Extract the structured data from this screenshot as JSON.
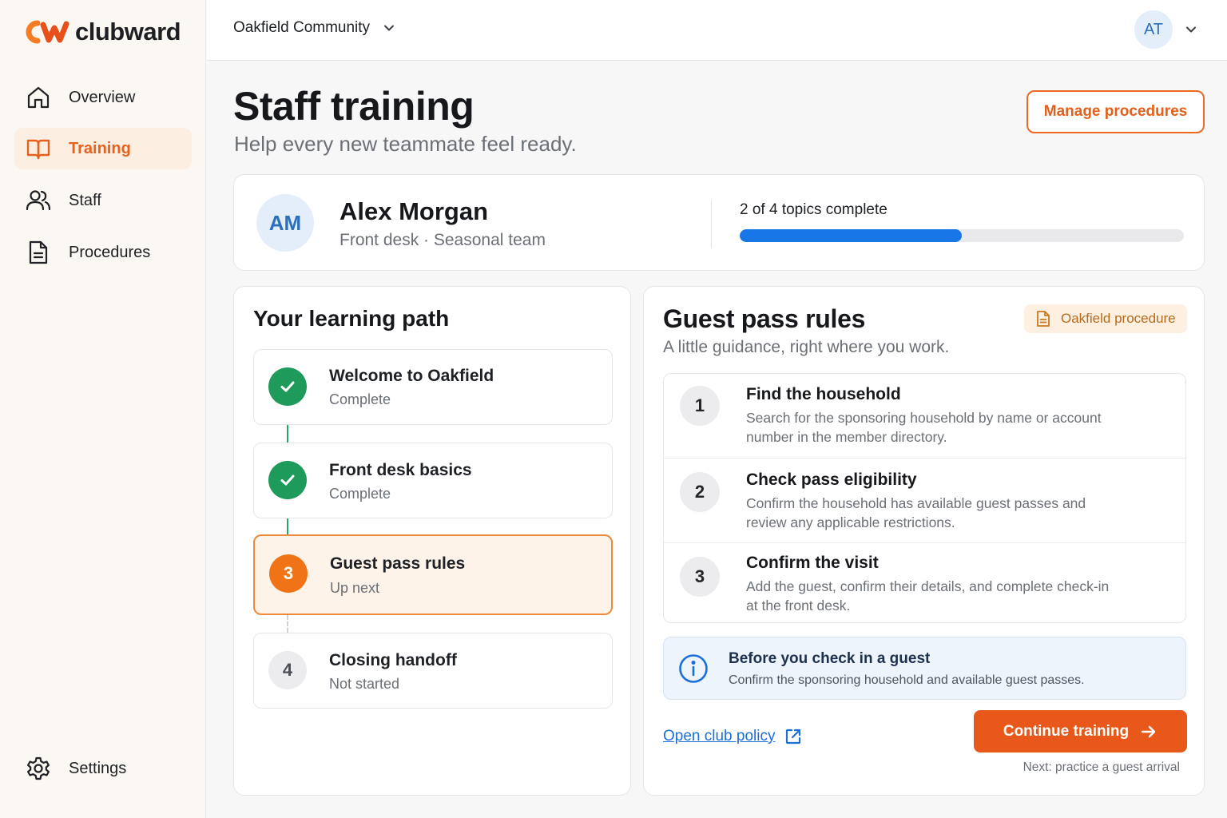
{
  "brand": {
    "name": "clubward",
    "accent": "#e8581a",
    "logo_colors": [
      "#f57c22",
      "#e8501a"
    ]
  },
  "sidebar": {
    "items": [
      {
        "label": "Overview",
        "icon": "home-icon",
        "active": false
      },
      {
        "label": "Training",
        "icon": "book-icon",
        "active": true
      },
      {
        "label": "Staff",
        "icon": "users-icon",
        "active": false
      },
      {
        "label": "Procedures",
        "icon": "document-icon",
        "active": false
      }
    ],
    "settings_label": "Settings"
  },
  "topbar": {
    "org_name": "Oakfield Community",
    "user_initials": "AT"
  },
  "header": {
    "title": "Staff training",
    "subtitle": "Help every new teammate feel ready.",
    "manage_button": "Manage procedures"
  },
  "profile": {
    "initials": "AM",
    "name": "Alex Morgan",
    "role": "Front desk · Seasonal team",
    "progress_text": "2 of 4 topics complete",
    "progress_fraction": 0.5,
    "progress_color": "#1976e6"
  },
  "learning_path": {
    "title": "Your learning path",
    "steps": [
      {
        "title": "Welcome to Oakfield",
        "status": "Complete",
        "state": "done"
      },
      {
        "title": "Front desk basics",
        "status": "Complete",
        "state": "done"
      },
      {
        "number": "3",
        "title": "Guest pass rules",
        "status": "Up next",
        "state": "current"
      },
      {
        "number": "4",
        "title": "Closing handoff",
        "status": "Not started",
        "state": "todo"
      }
    ]
  },
  "guide": {
    "title": "Guest pass rules",
    "subtitle": "A little guidance, right where you work.",
    "tag": "Oakfield procedure",
    "instructions": [
      {
        "number": "1",
        "title": "Find the household",
        "description_lines": [
          "Search for the sponsoring household by name or account",
          "number in the member directory."
        ]
      },
      {
        "number": "2",
        "title": "Check pass eligibility",
        "description_lines": [
          "Confirm the household has available guest passes and",
          "review any applicable restrictions."
        ]
      },
      {
        "number": "3",
        "title": "Confirm the visit",
        "description_lines": [
          "Add the guest, confirm their details, and complete check-in",
          "at the front desk."
        ]
      }
    ],
    "callout": {
      "title": "Before you check in a guest",
      "text": "Confirm the sponsoring household and available guest passes."
    },
    "policy_link": "Open club policy",
    "continue_button": "Continue training",
    "next_note": "Next: practice a guest arrival"
  }
}
